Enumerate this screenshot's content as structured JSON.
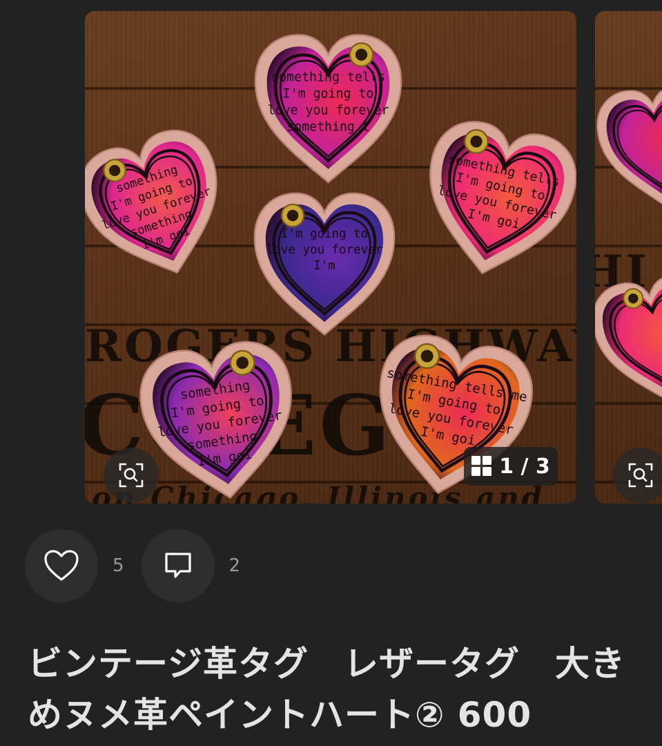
{
  "gallery": {
    "counter_text": "1 / 3",
    "image_description_alt": "",
    "hearts": [
      {
        "id": "top-center",
        "fill": "#ee2a55",
        "accent": "#c2239a",
        "text_lines": [
          "something tells",
          "I'm going to",
          "love you forever",
          "something t"
        ]
      },
      {
        "id": "left",
        "fill": "#f25a4b",
        "accent": "#e0268f",
        "text_lines": [
          "something",
          "I'm going to",
          "love you forever",
          "something",
          "I'm goi"
        ]
      },
      {
        "id": "center",
        "fill": "#6a2bb0",
        "accent": "#3b2a8c",
        "text_lines": [
          "I'm going to",
          "love you forever",
          "I'm"
        ]
      },
      {
        "id": "right",
        "fill": "#f45a3c",
        "accent": "#ee2a75",
        "text_lines": [
          "something tells",
          "I'm going to",
          "love you forever",
          "I'm goi"
        ]
      },
      {
        "id": "bottom-left",
        "fill": "#f03f5a",
        "accent": "#8b2bb0",
        "text_lines": [
          "something",
          "I'm going to",
          "love you forever",
          "something",
          "I'm goi"
        ]
      },
      {
        "id": "bottom-right",
        "fill": "#ee2a55",
        "accent": "#e0681e",
        "text_lines": [
          "something tells me",
          "I'm going to",
          "love you forever",
          "I'm goi"
        ]
      }
    ],
    "stencil_lines": [
      "ROGERS HIGHWAY",
      "CO  EG",
      "on Chicago, Illinois and"
    ]
  },
  "actions": {
    "like_count": "5",
    "comment_count": "2"
  },
  "product": {
    "title": "ビンテージ革タグ　レザータグ　大きめヌメ革ペイントハート② 600"
  },
  "colors": {
    "background": "#222222",
    "button_bg": "#2e2e2e",
    "leather_edge": "#d9a89a",
    "eyelet": "#c9a43a"
  },
  "icons": [
    "zoom-icon",
    "gallery-grid-icon",
    "heart-icon",
    "comment-icon"
  ]
}
